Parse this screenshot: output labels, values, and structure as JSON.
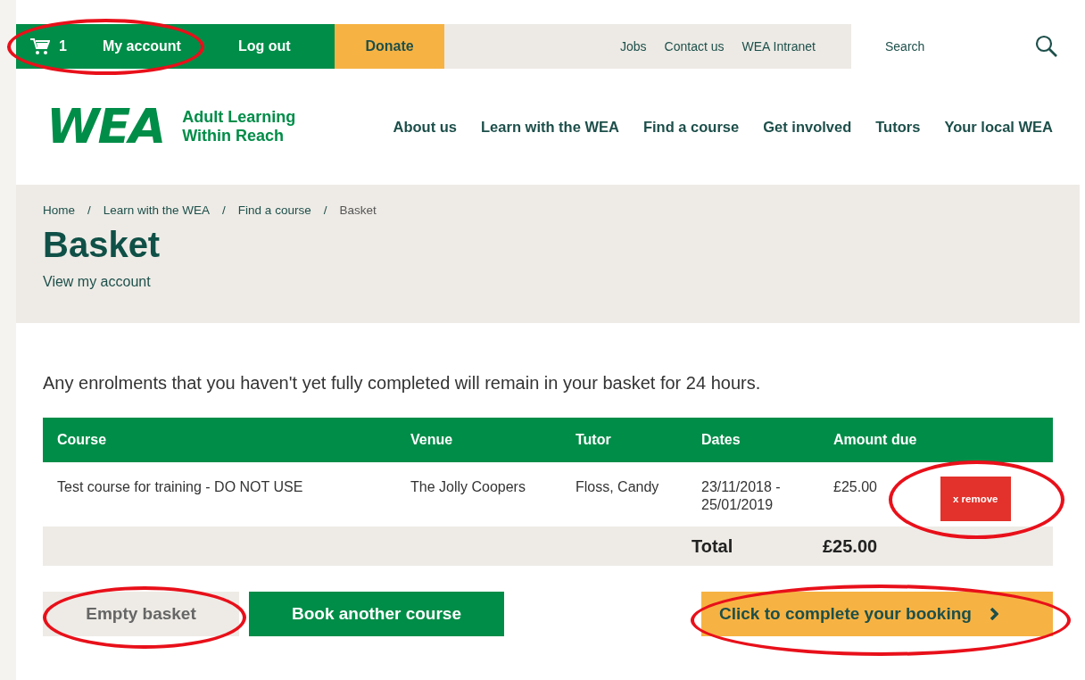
{
  "top_bar": {
    "account": {
      "cart_count": "1",
      "label": "My account",
      "circled": true
    },
    "log_out": "Log out",
    "donate": "Donate",
    "links": [
      "Jobs",
      "Contact us",
      "WEA Intranet"
    ],
    "search": {
      "placeholder": "Search"
    }
  },
  "header": {
    "logo": {
      "mark": "WEA",
      "tagline": "Adult Learning Within Reach"
    },
    "nav": [
      "About us",
      "Learn with the WEA",
      "Find a course",
      "Get involved",
      "Tutors",
      "Your local WEA"
    ]
  },
  "breadcrumb": [
    {
      "label": "Home"
    },
    {
      "separator": "/",
      "label": "Learn with the WEA"
    },
    {
      "separator": "/",
      "label": "Find a course"
    },
    {
      "separator": "/",
      "label": "Basket"
    }
  ],
  "page_title": "Basket",
  "account_link": "View my account",
  "notice": "Any enrolments that you haven't yet fully completed will remain in your basket for 24 hours.",
  "table": {
    "columns": [
      "Course",
      "Venue",
      "Tutor",
      "Dates",
      "Amount due"
    ],
    "rows": [
      {
        "cells": [
          "Test course for training - DO NOT USE",
          "The Jolly Coopers",
          "Floss, Candy",
          "23/11/2018 - 25/01/2019",
          "£25.00"
        ],
        "remove": {
          "label": "x remove",
          "circled": true
        }
      }
    ],
    "total": {
      "label": "Total",
      "amount": "£25.00"
    }
  },
  "buttons": [
    {
      "kind": "secondary",
      "label": "Empty basket",
      "circled": true
    },
    {
      "kind": "primary",
      "label": "Book another course",
      "circled": false
    },
    {
      "kind": "cta",
      "label": "Click to complete your booking",
      "circled": true
    }
  ]
}
